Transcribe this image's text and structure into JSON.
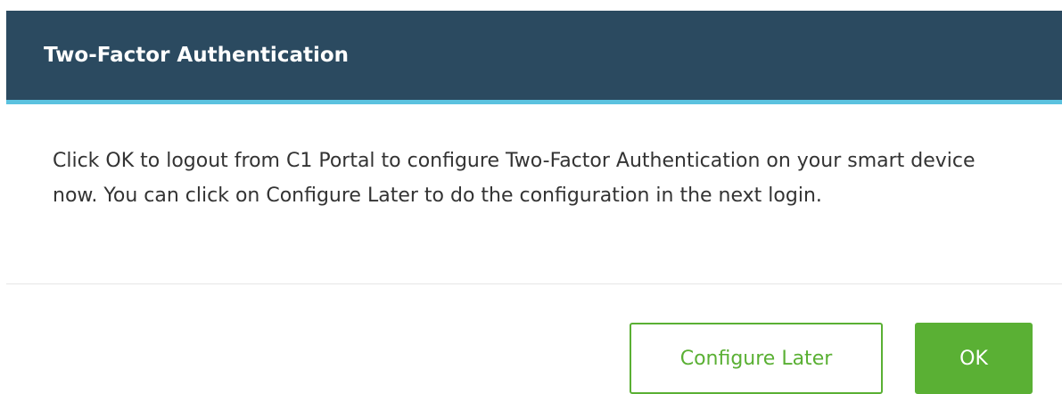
{
  "dialog": {
    "title": "Two-Factor Authentication",
    "message": "Click OK to logout from C1 Portal to configure Two-Factor Authentication on your smart device now. You can click on Configure Later to do the configuration in the next login.",
    "buttons": {
      "configure_later_label": "Configure Later",
      "ok_label": "OK"
    }
  },
  "colors": {
    "header_bg": "#2b4a60",
    "header_accent": "#5bc2df",
    "primary_green": "#5ab034"
  }
}
